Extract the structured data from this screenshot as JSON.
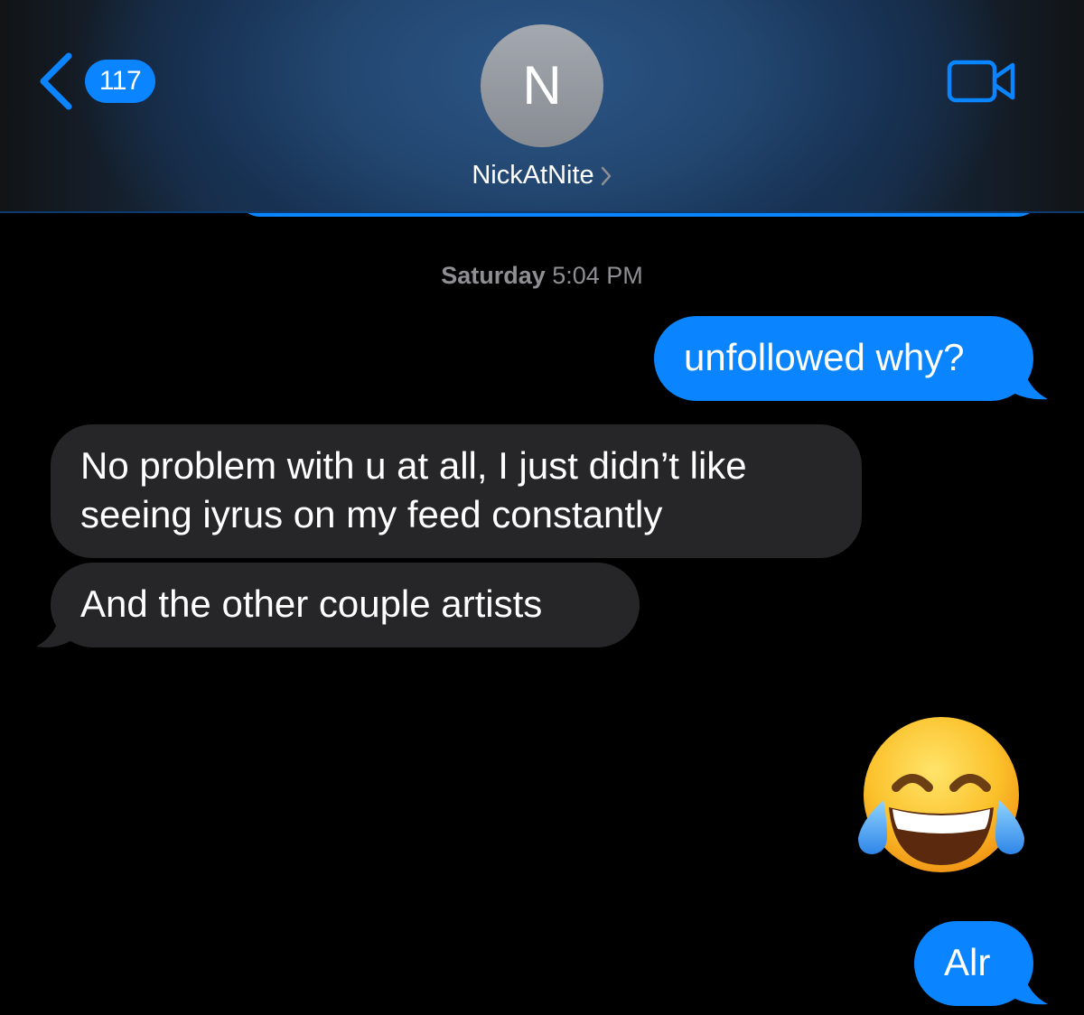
{
  "header": {
    "back_count": "117",
    "avatar_initial": "N",
    "contact_name": "NickAtNite"
  },
  "colors": {
    "accent": "#0a84ff",
    "received_bubble": "#262628",
    "timestamp_text": "#8e8e93",
    "background": "#000000"
  },
  "icons": {
    "back": "chevron-left-icon",
    "contact_chevron": "chevron-right-icon",
    "video": "video-camera-icon"
  },
  "timestamp": {
    "day": "Saturday",
    "time": "5:04 PM"
  },
  "messages": [
    {
      "direction": "sent",
      "text": "unfollowed why?"
    },
    {
      "direction": "received",
      "text": "No problem with u at all, I just didn’t like seeing iyrus on my feed constantly"
    },
    {
      "direction": "received",
      "text": "And the other couple artists"
    },
    {
      "direction": "sent",
      "emoji": "face-with-tears-of-joy"
    },
    {
      "direction": "sent",
      "text": "Alr"
    }
  ]
}
